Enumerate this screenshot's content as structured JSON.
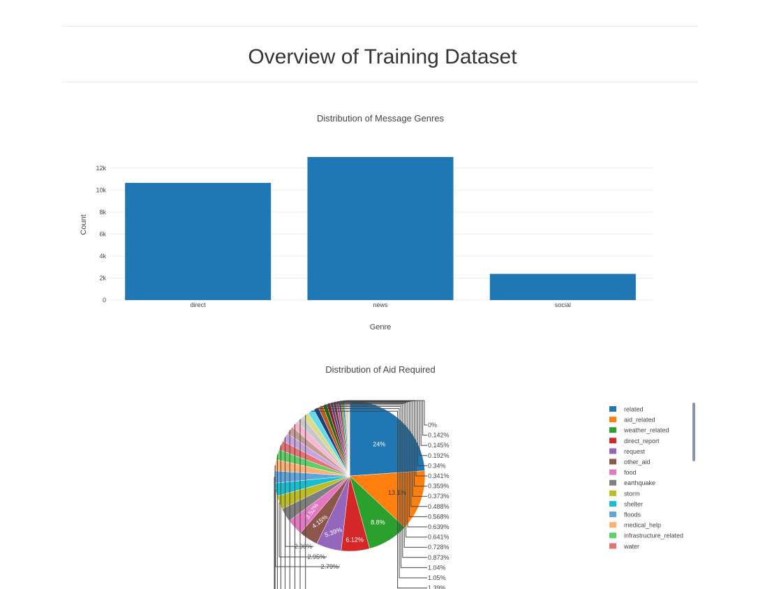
{
  "page": {
    "title": "Overview of Training Dataset"
  },
  "chart_data": [
    {
      "type": "bar",
      "title": "Distribution of Message Genres",
      "xlabel": "Genre",
      "ylabel": "Count",
      "categories": [
        "direct",
        "news",
        "social"
      ],
      "values": [
        10650,
        13000,
        2380
      ],
      "ylim": [
        0,
        13000
      ],
      "y_ticks": [
        0,
        2000,
        4000,
        6000,
        8000,
        10000,
        12000
      ],
      "y_tick_labels": [
        "0",
        "2k",
        "4k",
        "6k",
        "8k",
        "10k",
        "12k"
      ],
      "grid": true,
      "color": "#1f77b4"
    },
    {
      "type": "pie",
      "title": "Distribution of Aid Required",
      "legend_position": "right",
      "slices": [
        {
          "label": "related",
          "percent": 24.0,
          "text": "24%",
          "color": "#1f77b4"
        },
        {
          "label": "aid_related",
          "percent": 13.1,
          "text": "13.1%",
          "color": "#ff7f0e"
        },
        {
          "label": "weather_related",
          "percent": 8.8,
          "text": "8.8%",
          "color": "#2ca02c"
        },
        {
          "label": "direct_report",
          "percent": 6.12,
          "text": "6.12%",
          "color": "#d62728"
        },
        {
          "label": "request",
          "percent": 5.39,
          "text": "5.39%",
          "color": "#9467bd"
        },
        {
          "label": "other_aid",
          "percent": 4.15,
          "text": "4.15%",
          "color": "#8c564b"
        },
        {
          "label": "food",
          "percent": 3.52,
          "text": "3.52%",
          "color": "#e377c2"
        },
        {
          "label": "earthquake",
          "percent": 2.96,
          "text": "2.96%",
          "color": "#7f7f7f"
        },
        {
          "label": "storm",
          "percent": 2.95,
          "text": "2.95%",
          "color": "#bcbd22"
        },
        {
          "label": "shelter",
          "percent": 2.79,
          "text": "2.79%",
          "color": "#17becf"
        },
        {
          "label": "floods",
          "percent": 2.6,
          "text": "",
          "color": "#5da5da"
        },
        {
          "label": "medical_help",
          "percent": 2.4,
          "text": "",
          "color": "#ffb172"
        },
        {
          "label": "infrastructure_related",
          "percent": 2.2,
          "text": "",
          "color": "#5fd068"
        },
        {
          "label": "water",
          "percent": 2.0,
          "text": "",
          "color": "#e57373"
        },
        {
          "label": "",
          "percent": 1.9,
          "text": "",
          "color": "#c7a4e0"
        },
        {
          "label": "",
          "percent": 1.7,
          "text": "",
          "color": "#c49c94"
        },
        {
          "label": "",
          "percent": 1.6,
          "text": "",
          "color": "#f7b6d2"
        },
        {
          "label": "",
          "percent": 1.5,
          "text": "",
          "color": "#c7c7c7"
        },
        {
          "label": "",
          "percent": 1.4,
          "text": "",
          "color": "#dbdb8d"
        },
        {
          "label": "",
          "percent": 1.39,
          "text": "1.39%",
          "color": "#62dcea"
        },
        {
          "label": "",
          "percent": 1.05,
          "text": "1.05%",
          "color": "#1f3f7a"
        },
        {
          "label": "",
          "percent": 1.04,
          "text": "1.04%",
          "color": "#bf5b17"
        },
        {
          "label": "",
          "percent": 0.873,
          "text": "0.873%",
          "color": "#176b17"
        },
        {
          "label": "",
          "percent": 0.728,
          "text": "0.728%",
          "color": "#8b1a1a"
        },
        {
          "label": "",
          "percent": 0.641,
          "text": "0.641%",
          "color": "#5a3f8a"
        },
        {
          "label": "",
          "percent": 0.639,
          "text": "0.639%",
          "color": "#6b3d32"
        },
        {
          "label": "",
          "percent": 0.568,
          "text": "0.568%",
          "color": "#b04a98"
        },
        {
          "label": "",
          "percent": 0.488,
          "text": "0.488%",
          "color": "#555555"
        },
        {
          "label": "",
          "percent": 0.373,
          "text": "0.373%",
          "color": "#8c8c1a"
        },
        {
          "label": "",
          "percent": 0.359,
          "text": "0.359%",
          "color": "#138d99"
        },
        {
          "label": "",
          "percent": 0.341,
          "text": "0.341%",
          "color": "#aec7e8"
        },
        {
          "label": "",
          "percent": 0.34,
          "text": "0.34%",
          "color": "#ffbb78"
        },
        {
          "label": "",
          "percent": 0.192,
          "text": "0.192%",
          "color": "#98df8a"
        },
        {
          "label": "",
          "percent": 0.145,
          "text": "0.145%",
          "color": "#ff9896"
        },
        {
          "label": "",
          "percent": 0.142,
          "text": "0.142%",
          "color": "#c5b0d5"
        },
        {
          "label": "",
          "percent": 0.0,
          "text": "0%",
          "color": "#1f77b4"
        }
      ],
      "legend_items": [
        {
          "label": "related",
          "color": "#1f77b4"
        },
        {
          "label": "aid_related",
          "color": "#ff7f0e"
        },
        {
          "label": "weather_related",
          "color": "#2ca02c"
        },
        {
          "label": "direct_report",
          "color": "#d62728"
        },
        {
          "label": "request",
          "color": "#9467bd"
        },
        {
          "label": "other_aid",
          "color": "#8c564b"
        },
        {
          "label": "food",
          "color": "#e377c2"
        },
        {
          "label": "earthquake",
          "color": "#7f7f7f"
        },
        {
          "label": "storm",
          "color": "#bcbd22"
        },
        {
          "label": "shelter",
          "color": "#17becf"
        },
        {
          "label": "floods",
          "color": "#5da5da"
        },
        {
          "label": "medical_help",
          "color": "#ffb172"
        },
        {
          "label": "infrastructure_related",
          "color": "#5fd068"
        },
        {
          "label": "water",
          "color": "#e57373"
        }
      ]
    }
  ]
}
